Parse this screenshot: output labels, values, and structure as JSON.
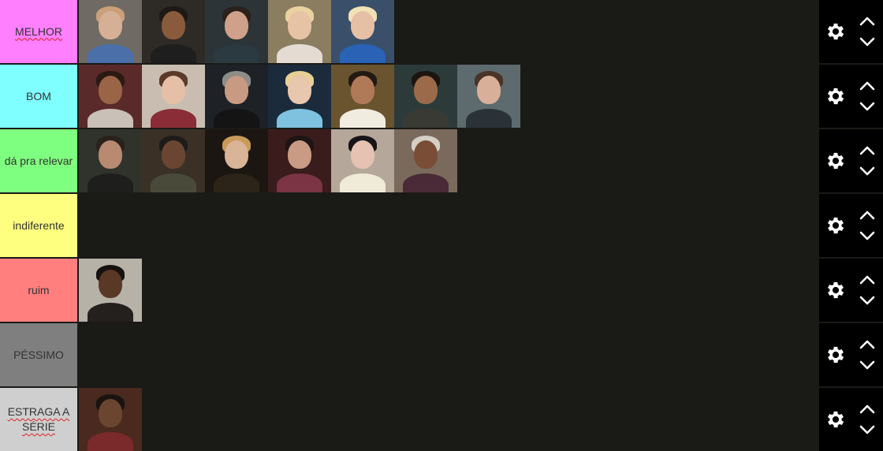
{
  "tiers": [
    {
      "label": "MELHOR",
      "color": "#ff7fff",
      "spell_underline": true,
      "items": [
        {
          "name": "character-1",
          "bg": "#6f6a63",
          "skin": "#d6b096",
          "hair": "#c9a07a",
          "shirt": "#4b6fa8"
        },
        {
          "name": "character-2",
          "bg": "#2e2b27",
          "skin": "#8a5a3d",
          "hair": "#1d1915",
          "shirt": "#1f1e1e"
        },
        {
          "name": "character-3",
          "bg": "#2c3438",
          "skin": "#cfa18a",
          "hair": "#2b201a",
          "shirt": "#2a3a40"
        },
        {
          "name": "character-4",
          "bg": "#8a7d60",
          "skin": "#e7c3a6",
          "hair": "#e8d3a0",
          "shirt": "#e4dcd2"
        },
        {
          "name": "character-5",
          "bg": "#3a4f6a",
          "skin": "#e6c0a5",
          "hair": "#f1e2b6",
          "shirt": "#2a63b5"
        }
      ]
    },
    {
      "label": "BOM",
      "color": "#7fffff",
      "spell_underline": false,
      "items": [
        {
          "name": "character-6",
          "bg": "#5a2a2a",
          "skin": "#9a6546",
          "hair": "#2a1a12",
          "shirt": "#c9c0b8"
        },
        {
          "name": "character-7",
          "bg": "#c9bdb2",
          "skin": "#e6c0a6",
          "hair": "#5a3a28",
          "shirt": "#8a2d36"
        },
        {
          "name": "character-8",
          "bg": "#1e2226",
          "skin": "#c89a82",
          "hair": "#8d8d8a",
          "shirt": "#141414"
        },
        {
          "name": "character-9",
          "bg": "#1b2b3c",
          "skin": "#e7c7ad",
          "hair": "#e8cf94",
          "shirt": "#7fc2e0"
        },
        {
          "name": "character-10",
          "bg": "#6a5430",
          "skin": "#b07a58",
          "hair": "#221a12",
          "shirt": "#f0ece0"
        },
        {
          "name": "character-11",
          "bg": "#2c3a3a",
          "skin": "#9a6a4a",
          "hair": "#1c1410",
          "shirt": "#3a3a35"
        },
        {
          "name": "character-12",
          "bg": "#5d6a6e",
          "skin": "#d8b09a",
          "hair": "#4a3428",
          "shirt": "#2a3238"
        }
      ]
    },
    {
      "label": "dá pra relevar",
      "color": "#7fff7f",
      "spell_underline": false,
      "items": [
        {
          "name": "character-13",
          "bg": "#30332c",
          "skin": "#b88a72",
          "hair": "#2a211b",
          "shirt": "#1e1e1c"
        },
        {
          "name": "character-14",
          "bg": "#3a3026",
          "skin": "#6a4632",
          "hair": "#1e1c1a",
          "shirt": "#4a4a3a"
        },
        {
          "name": "character-15",
          "bg": "#1c1612",
          "skin": "#d9b497",
          "hair": "#c99a5a",
          "shirt": "#2c2418"
        },
        {
          "name": "character-16",
          "bg": "#3a1c1c",
          "skin": "#c99a84",
          "hair": "#1e1414",
          "shirt": "#7a3444"
        },
        {
          "name": "character-17",
          "bg": "#b5a89a",
          "skin": "#e6c2b2",
          "hair": "#191417",
          "shirt": "#f0ead8"
        },
        {
          "name": "character-18",
          "bg": "#7a6a5c",
          "skin": "#7a4e36",
          "hair": "#d6cfc6",
          "shirt": "#4a2a36"
        }
      ]
    },
    {
      "label": "indiferente",
      "color": "#ffff7f",
      "spell_underline": false,
      "items": []
    },
    {
      "label": "ruim",
      "color": "#ff7f7f",
      "spell_underline": false,
      "items": [
        {
          "name": "character-19",
          "bg": "#b7b2a8",
          "skin": "#5a3826",
          "hair": "#161210",
          "shirt": "#24201e"
        }
      ]
    },
    {
      "label": "PÉSSIMO",
      "color": "#7f7f7f",
      "spell_underline": false,
      "items": []
    },
    {
      "label": "ESTRAGA A SÉRIE",
      "color": "#cfcfcf",
      "spell_underline": true,
      "items": [
        {
          "name": "character-20",
          "bg": "#4a2a1e",
          "skin": "#6a4630",
          "hair": "#1a1410",
          "shirt": "#7a2a2a"
        }
      ]
    }
  ],
  "icons": {
    "settings": "gear-icon",
    "up": "chevron-up-icon",
    "down": "chevron-down-icon"
  },
  "colors": {
    "background": "#1a1a17",
    "controls": "#000000"
  }
}
